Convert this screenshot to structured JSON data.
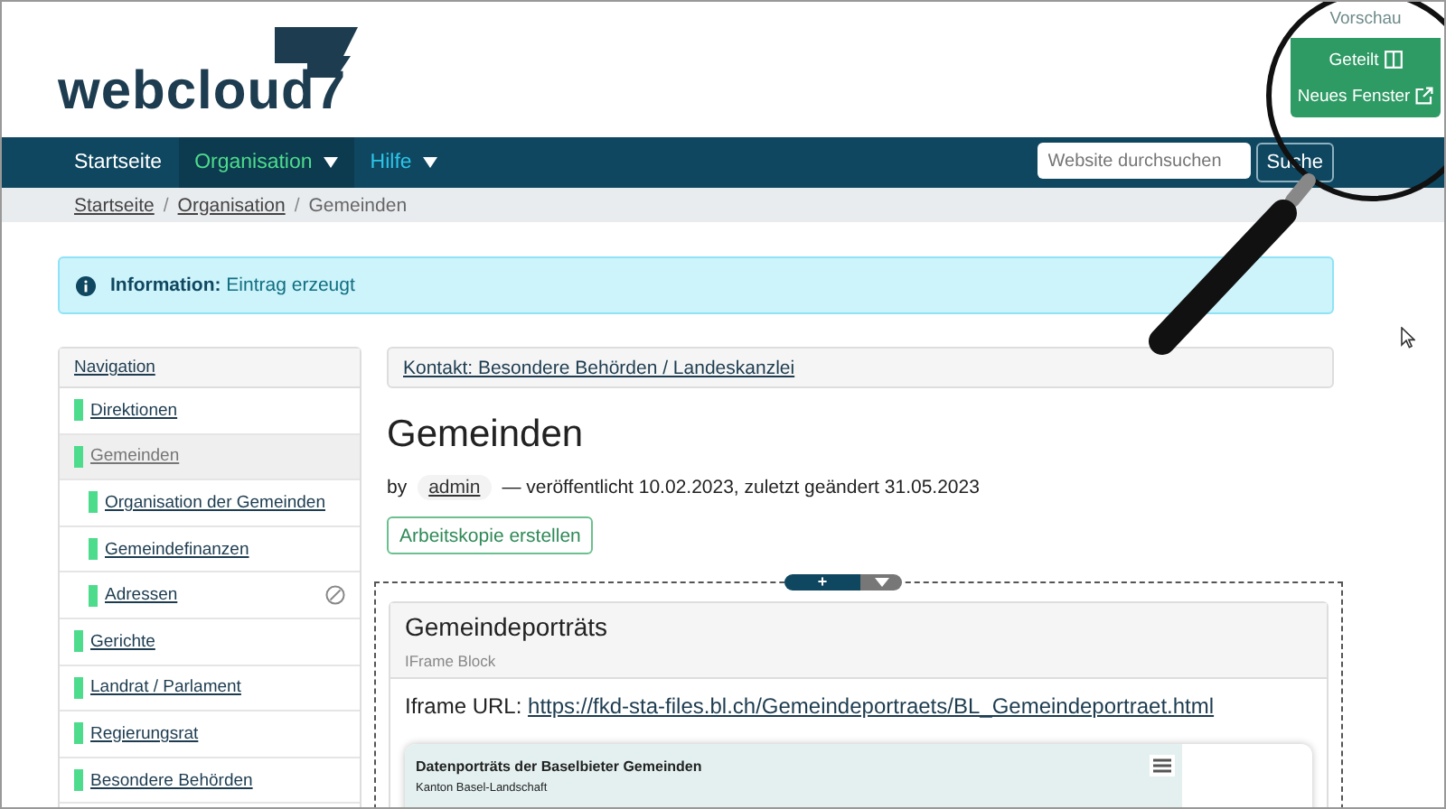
{
  "logo": {
    "text": "webcloud7"
  },
  "preview_menu": {
    "title": "Vorschau",
    "options": [
      {
        "label": "Geteilt",
        "kind": "split"
      },
      {
        "label": "Neues Fenster",
        "kind": "external"
      }
    ]
  },
  "nav": {
    "items": [
      {
        "label": "Startseite",
        "selected": false,
        "dropdown": false,
        "color": "#ffffff"
      },
      {
        "label": "Organisation",
        "selected": true,
        "dropdown": true,
        "color": "#4ddb8c"
      },
      {
        "label": "Hilfe",
        "selected": false,
        "dropdown": true,
        "color": "#2cc4e8"
      }
    ]
  },
  "search": {
    "placeholder": "Website durchsuchen",
    "button": "Suche"
  },
  "breadcrumbs": [
    {
      "label": "Startseite",
      "link": true
    },
    {
      "separator": "/",
      "label": "Organisation",
      "link": true
    },
    {
      "separator": "/",
      "label": "Gemeinden",
      "link": false
    }
  ],
  "alert": {
    "label": "Information:",
    "text": "Eintrag erzeugt"
  },
  "sidebar": {
    "title": "Navigation",
    "items": [
      {
        "label": "Direktionen",
        "selected": false,
        "excluded": false
      },
      {
        "label": "Gemeinden",
        "selected": true,
        "excluded": false,
        "children": [
          {
            "label": "Organisation der Gemeinden",
            "selected": false,
            "excluded": false
          },
          {
            "label": "Gemeindefinanzen",
            "selected": false,
            "excluded": false
          },
          {
            "label": "Adressen",
            "selected": false,
            "excluded": true
          }
        ]
      },
      {
        "label": "Gerichte",
        "selected": false,
        "excluded": false
      },
      {
        "label": "Landrat / Parlament",
        "selected": false,
        "excluded": false
      },
      {
        "label": "Regierungsrat",
        "selected": false,
        "excluded": false
      },
      {
        "label": "Besondere Behörden",
        "selected": false,
        "excluded": false
      }
    ]
  },
  "main": {
    "context_link": "Kontakt: Besondere Behörden / Landeskanzlei",
    "title": "Gemeinden",
    "byline": {
      "prefix": "by",
      "author": "admin",
      "text": "— veröffentlicht 10.02.2023, zuletzt geändert 31.05.2023"
    },
    "action_button": "Arbeitskopie erstellen",
    "add_button": "+",
    "block": {
      "title": "Gemeindeporträts",
      "subtitle": "IFrame Block",
      "url_label": "Iframe URL:",
      "url": "https://fkd-sta-files.bl.ch/Gemeindeportraets/BL_Gemeindeportraet.html",
      "embed": {
        "title": "Datenporträts der Baselbieter Gemeinden",
        "subtitle": "Kanton Basel-Landschaft"
      }
    }
  }
}
